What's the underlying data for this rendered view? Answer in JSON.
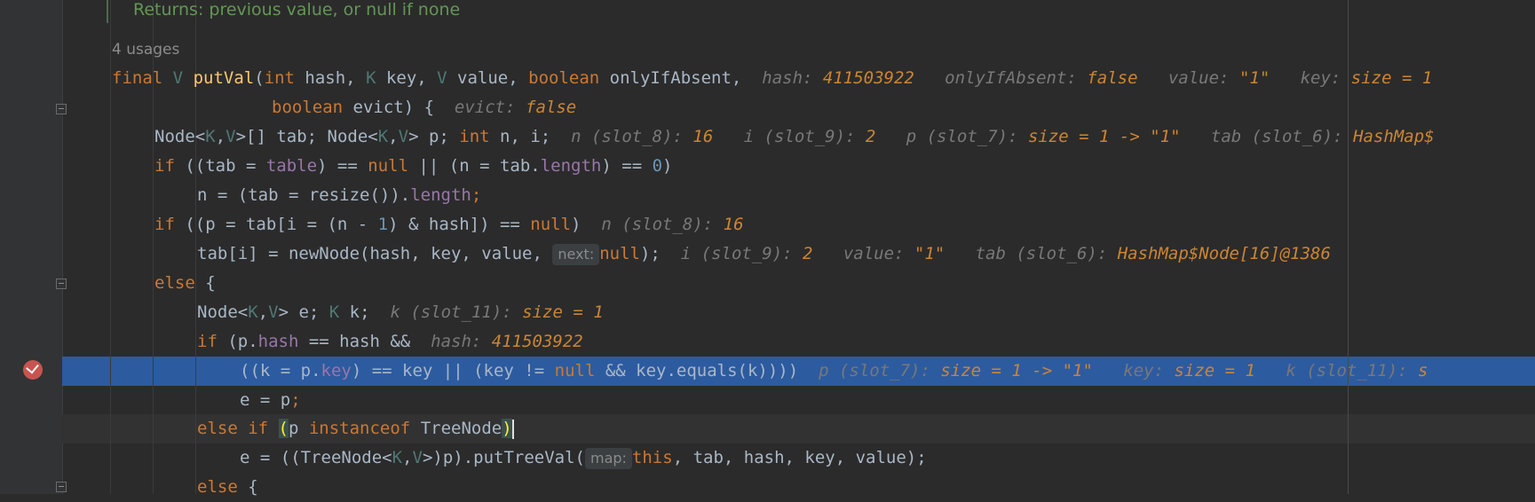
{
  "doc_comment": "Returns: previous value, or null if none",
  "usages": "4 usages",
  "code": {
    "l1": {
      "kw_final": "final",
      "tp_V": "V",
      "fn_putVal": "putVal",
      "p_open": "(",
      "kw_int": "int",
      "t_hash": " hash, ",
      "tp_K": "K",
      "t_key": " key, ",
      "tp_V2": "V",
      "t_value": " value, ",
      "kw_boolean": "boolean",
      "t_onlyIfAbsent": " onlyIfAbsent,"
    },
    "l1_hints": {
      "h1": "hash: ",
      "v1": "411503922",
      "h2": "onlyIfAbsent: ",
      "v2": "false",
      "h3": "value: ",
      "v3": "\"1\"",
      "h4": "key: ",
      "v4": "size = 1"
    },
    "l2": {
      "kw_boolean": "boolean",
      "t_evict": " evict) {"
    },
    "l2_hints": {
      "h1": "evict: ",
      "v1": "false"
    },
    "l3": {
      "t1": "Node<",
      "tp_K": "K",
      "c1": ",",
      "tp_V": "V",
      "t2": ">[] tab; Node<",
      "tp_K2": "K",
      "c2": ",",
      "tp_V2": "V",
      "t3": "> p; ",
      "kw_int": "int",
      "t4": " n, i;"
    },
    "l3_hints": {
      "h1": "n (slot_8): ",
      "v1": "16",
      "h2": "i (slot_9): ",
      "v2": "2",
      "h3": "p (slot_7): ",
      "v3": "size = 1 -> \"1\"",
      "h4": "tab (slot_6): ",
      "v4": "HashMap$"
    },
    "l4": {
      "kw_if": "if",
      "t1": " ((tab = ",
      "fld_table": "table",
      "t2": ") == ",
      "kw_null": "null",
      "t3": " || (n = tab.",
      "fld_length": "length",
      "t4": ") == ",
      "num_0": "0",
      "t5": ")"
    },
    "l5": {
      "t1": "n = (tab = resize()).",
      "fld_length": "length",
      "t2": ";"
    },
    "l6": {
      "kw_if": "if",
      "t1": " ((p = tab[i = (n - ",
      "num_1": "1",
      "t2": ") & hash]) == ",
      "kw_null": "null",
      "t3": ")"
    },
    "l6_hints": {
      "h1": "n (slot_8): ",
      "v1": "16"
    },
    "l7": {
      "t1": "tab[i] = newNode(hash, key, value, ",
      "param": "next:",
      "kw_null": "null",
      "t2": ");"
    },
    "l7_hints": {
      "h1": "i (slot_9): ",
      "v1": "2",
      "h2": "value: ",
      "v2": "\"1\"",
      "h3": "tab (slot_6): ",
      "v3": "HashMap$Node[16]@1386"
    },
    "l8": {
      "kw_else": "else",
      "t1": " {"
    },
    "l9": {
      "t1": "Node<",
      "tp_K": "K",
      "c1": ",",
      "tp_V": "V",
      "t2": "> e; ",
      "tp_K2": "K",
      "t3": " k;"
    },
    "l9_hints": {
      "h1": "k (slot_11): ",
      "v1": "size = 1"
    },
    "l10": {
      "kw_if": "if",
      "t1": " (p.",
      "fld_hash": "hash",
      "t2": " == hash &&"
    },
    "l10_hints": {
      "h1": "hash: ",
      "v1": "411503922"
    },
    "l11": {
      "t1": "((k = p.",
      "fld_key": "key",
      "t2": ") == key || (key != ",
      "kw_null": "null",
      "t3": " && key.equals(k))))"
    },
    "l11_hints": {
      "h1": "p (slot_7): ",
      "v1": "size = 1 -> \"1\"",
      "h2": "key: ",
      "v2": "size = 1",
      "h3": "k (slot_11): ",
      "v3": "s"
    },
    "l12": {
      "t1": "e = p",
      "kw_semi": ";"
    },
    "l13": {
      "kw_else": "else if ",
      "br_open": "(",
      "t1": "p ",
      "kw_instanceof": "instanceof",
      "t2": " TreeNode",
      "br_close": ")"
    },
    "l14": {
      "t1": "e = ((TreeNode<",
      "tp_K": "K",
      "c1": ",",
      "tp_V": "V",
      "t2": ">)p).putTreeVal(",
      "param": "map:",
      "kw_this": "this",
      "t3": ", tab, hash, key, value);"
    },
    "l15": {
      "kw_else": "else",
      "t1": " {"
    }
  },
  "colors": {
    "background": "#2b2b2b",
    "gutter": "#313335",
    "keyword": "#cc7832",
    "function": "#ffc66d",
    "type_param": "#507874",
    "field": "#9876aa",
    "number": "#6897bb",
    "hint_label": "#787878",
    "hint_value": "#cc8533",
    "highlight_row": "#2d5ba0",
    "breakpoint": "#c75450",
    "doc_comment": "#629755"
  },
  "icons": {
    "breakpoint": "breakpoint-check-icon",
    "fold": "fold-marker-icon"
  }
}
